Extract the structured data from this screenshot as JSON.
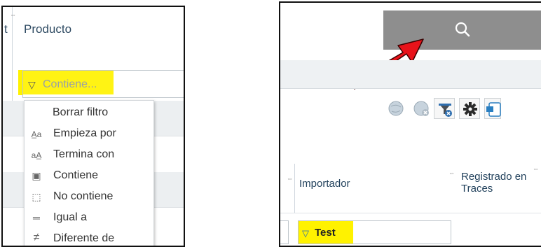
{
  "left": {
    "column_header": "Producto",
    "filter_placeholder": "Contiene...",
    "menu": [
      {
        "icon": "",
        "label": "Borrar filtro"
      },
      {
        "icon": "starts-with-icon",
        "label": "Empieza por"
      },
      {
        "icon": "ends-with-icon",
        "label": "Termina con"
      },
      {
        "icon": "contains-icon",
        "label": "Contiene"
      },
      {
        "icon": "not-contains-icon",
        "label": "No contiene"
      },
      {
        "icon": "equals-icon",
        "label": "Igual a"
      },
      {
        "icon": "not-equal-icon",
        "label": "Diferente de"
      }
    ],
    "icon_glyphs": {
      "starts_with": "A̲a",
      "ends_with": "aA̲",
      "contains": "▣",
      "not_contains": "⬚",
      "equals": "═",
      "not_equal": "≠"
    },
    "partial_header_char": "t"
  },
  "right": {
    "search_icon": "search-icon",
    "toolbar_icons": [
      "globe-icon",
      "globe-remove-icon",
      "clear-filter-icon",
      "gear-icon",
      "export-excel-icon"
    ],
    "columns": [
      "Importador",
      "Registrado en Traces"
    ],
    "filter_value": "Test"
  },
  "colors": {
    "highlight": "#fff200",
    "arrow": "#e8131a",
    "search_bar": "#8e8e8e",
    "header_text": "#2e4a62"
  }
}
